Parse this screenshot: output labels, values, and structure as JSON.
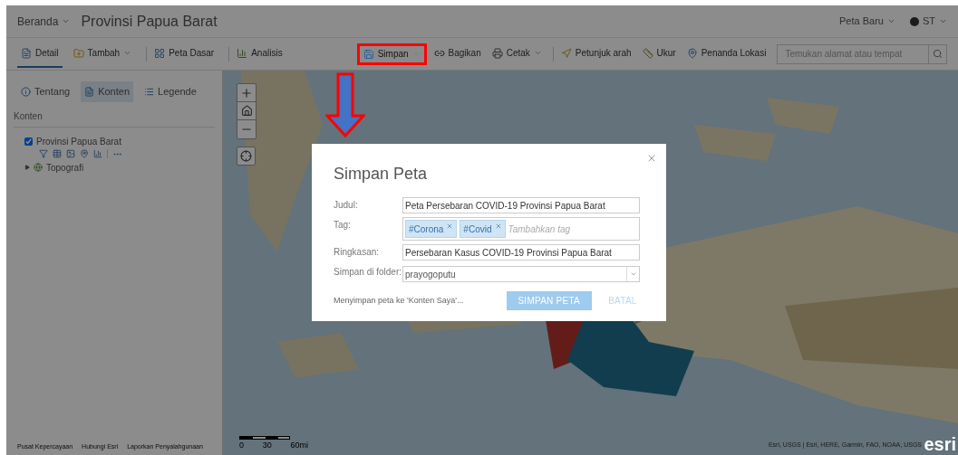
{
  "header": {
    "home_menu": "Beranda",
    "title": "Provinsi Papua Barat",
    "new_map": "Peta Baru",
    "user": "ST"
  },
  "toolbar": {
    "left_groups": [
      [
        {
          "label": "Detail",
          "dropdown": false,
          "selected": true,
          "annotated": false
        },
        {
          "label": "Tambah",
          "dropdown": true,
          "selected": false,
          "annotated": false
        }
      ],
      [
        {
          "label": "Peta Dasar",
          "dropdown": false,
          "selected": false,
          "annotated": false
        }
      ],
      [
        {
          "label": "Analisis",
          "dropdown": false,
          "selected": false,
          "annotated": false
        }
      ]
    ],
    "right_groups": [
      [
        {
          "label": "Simpan",
          "dropdown": true,
          "selected": false,
          "annotated": true
        },
        {
          "label": "Bagikan",
          "dropdown": false,
          "selected": false,
          "annotated": false
        },
        {
          "label": "Cetak",
          "dropdown": true,
          "selected": false,
          "annotated": false
        }
      ],
      [
        {
          "label": "Petunjuk arah",
          "dropdown": false,
          "selected": false,
          "annotated": false
        },
        {
          "label": "Ukur",
          "dropdown": false,
          "selected": false,
          "annotated": false
        },
        {
          "label": "Penanda Lokasi",
          "dropdown": false,
          "selected": false,
          "annotated": false
        }
      ]
    ],
    "search": {
      "placeholder": "Temukan alamat atau tempat"
    }
  },
  "sidebar": {
    "tabs": [
      {
        "label": "Tentang",
        "selected": false
      },
      {
        "label": "Konten",
        "selected": true
      },
      {
        "label": "Legende",
        "selected": false
      }
    ],
    "heading": "Konten",
    "layers": [
      {
        "kind": "layer",
        "name": "Provinsi Papua Barat",
        "checked": true
      },
      {
        "kind": "basemap",
        "name": "Topografi",
        "expanded": false
      }
    ],
    "footer_links": [
      "Pusat Kepercayaan",
      "Hubungi Esri",
      "Laporkan Penyalahgunaan"
    ]
  },
  "map": {
    "scale_labels": [
      "0",
      "30",
      "60mi"
    ],
    "attribution": "Esri, USGS | Esri, HERE, Garmin, FAO, NOAA, USGS",
    "logo": "esri"
  },
  "dialog": {
    "title": "Simpan Peta",
    "fields": [
      {
        "kind": "text",
        "label": "Judul:",
        "value": "Peta Persebaran COVID-19 Provinsi Papua Barat"
      },
      {
        "kind": "tags",
        "label": "Tag:",
        "tags": [
          "#Corona",
          "#Covid"
        ],
        "placeholder": "Tambahkan tag"
      },
      {
        "kind": "text",
        "label": "Ringkasan:",
        "value": "Persebaran Kasus COVID-19 Provinsi Papua Barat"
      },
      {
        "kind": "select",
        "label": "Simpan di folder:",
        "value": "prayogoputu"
      }
    ],
    "status": "Menyimpan peta ke 'Konten Saya'...",
    "buttons": [
      {
        "kind": "primary",
        "label": "SIMPAN PETA",
        "disabled": true
      },
      {
        "kind": "link",
        "label": "BATAL",
        "disabled": true
      }
    ]
  }
}
